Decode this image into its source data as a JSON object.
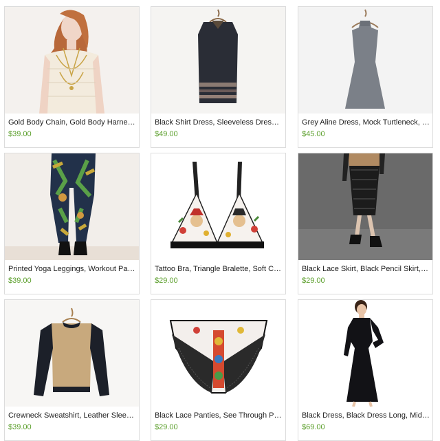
{
  "listings": [
    {
      "title": "Gold Body Chain, Gold Body Harness,...",
      "price": "$39.00",
      "image": "woman-in-gold-body-chain"
    },
    {
      "title": "Black Shirt Dress, Sleeveless Dress, Bl...",
      "price": "$49.00",
      "image": "black-shirt-dress-on-hanger"
    },
    {
      "title": "Grey Aline Dress, Mock Turtleneck, 9...",
      "price": "$45.00",
      "image": "grey-dress-on-hanger"
    },
    {
      "title": "Printed Yoga Leggings, Workout Pant...",
      "price": "$39.00",
      "image": "printed-leggings"
    },
    {
      "title": "Tattoo Bra, Triangle Bralette, Soft Cup...",
      "price": "$29.00",
      "image": "tattoo-print-bralette"
    },
    {
      "title": "Black Lace Skirt, Black Pencil Skirt, Hi...",
      "price": "$29.00",
      "image": "black-lace-skirt"
    },
    {
      "title": "Crewneck Sweatshirt, Leather Sleeve...",
      "price": "$39.00",
      "image": "tan-sweatshirt-on-hanger"
    },
    {
      "title": "Black Lace Panties, See Through Pant...",
      "price": "$29.00",
      "image": "printed-lace-panties"
    },
    {
      "title": "Black Dress, Black Dress Long, Midi D...",
      "price": "$69.00",
      "image": "woman-in-black-midi-dress"
    }
  ],
  "colors": {
    "price": "#5a9e2a",
    "card_border": "#dcdcdc",
    "title": "#222222"
  }
}
